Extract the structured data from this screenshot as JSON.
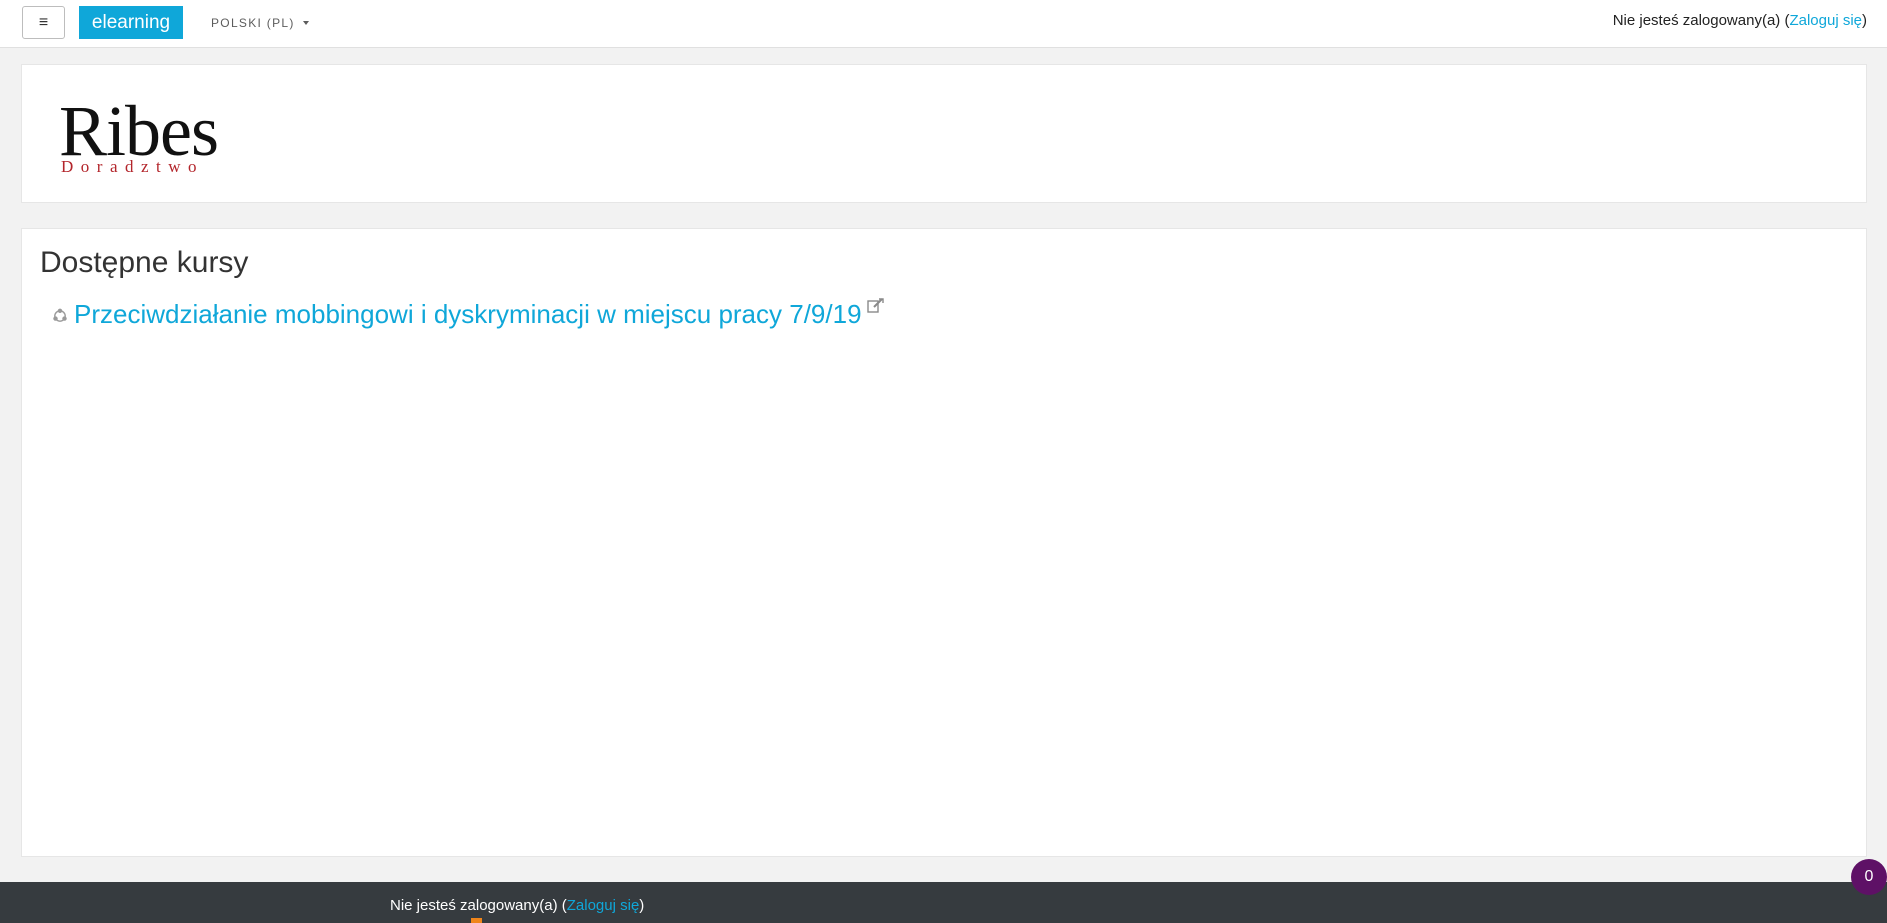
{
  "navbar": {
    "menu_icon": "≡",
    "brand": "elearning",
    "language": "POLSKI (PL)",
    "login_prefix": "Nie jesteś zalogowany(a) (",
    "login_link": "Zaloguj się",
    "login_suffix": ")"
  },
  "header": {
    "logo_main": "Ribes",
    "logo_sub": "Doradztwo"
  },
  "main": {
    "section_title": "Dostępne kursy",
    "courses": [
      {
        "name": "Przeciwdziałanie mobbingowi i dyskryminacji w miejscu pracy 7/9/19"
      }
    ]
  },
  "footer": {
    "login_prefix": "Nie jesteś zalogowany(a) (",
    "login_link": "Zaloguj się",
    "login_suffix": ")"
  },
  "badge": {
    "count": "0"
  },
  "colors": {
    "accent": "#0fa7d9",
    "footer_bg": "#363b3f",
    "badge_bg": "#5e1166",
    "logo_sub": "#b3252b"
  }
}
